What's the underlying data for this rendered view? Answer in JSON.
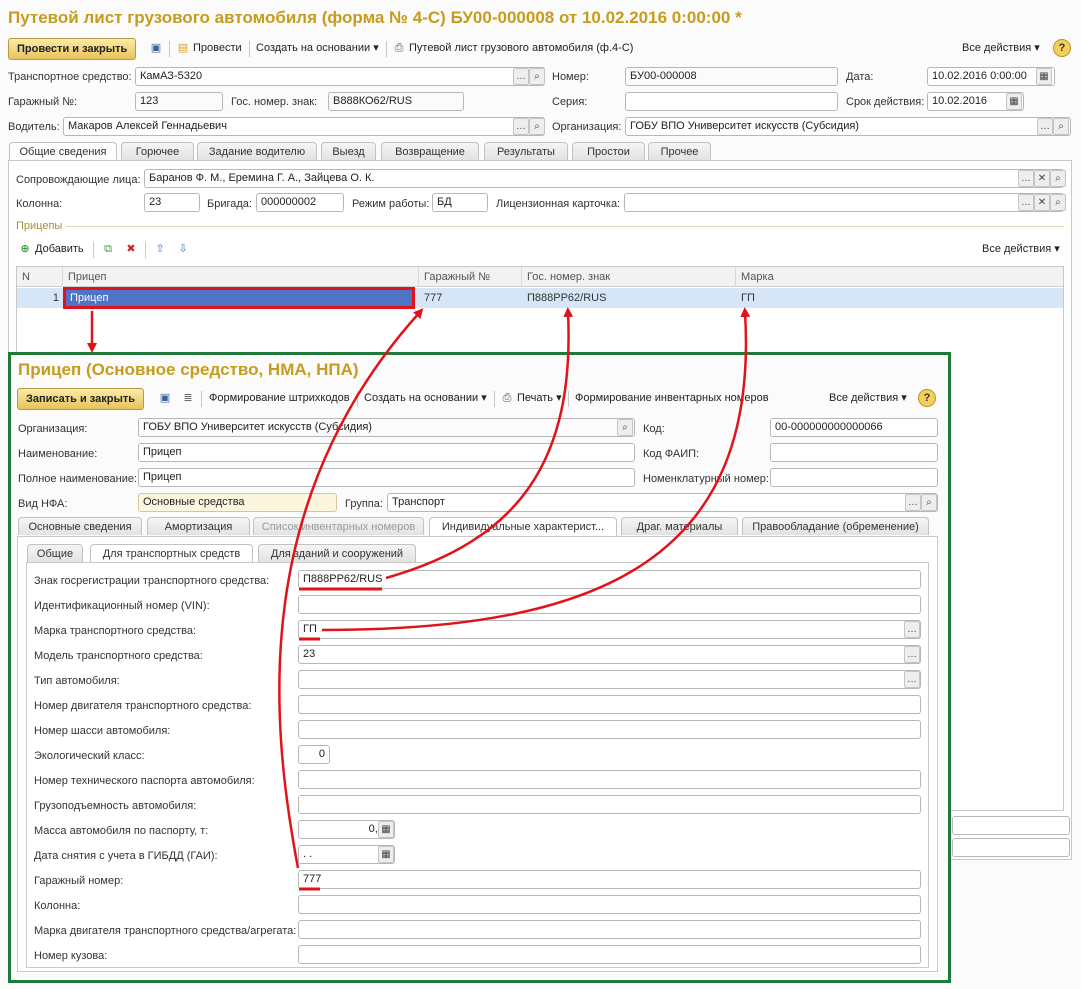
{
  "main": {
    "title": "Путевой лист грузового автомобиля (форма № 4-С) БУ00-000008 от 10.02.2016 0:00:00 *",
    "toolbar": {
      "post_close": "Провести и закрыть",
      "post": "Провести",
      "create_based": "Создать на основании",
      "print_form": "Путевой лист грузового автомобиля (ф.4-С)",
      "all_actions": "Все действия"
    },
    "fields": {
      "vehicle_label": "Транспортное средство:",
      "vehicle_value": "КамАЗ-5320",
      "number_label": "Номер:",
      "number_value": "БУ00-000008",
      "date_label": "Дата:",
      "date_value": "10.02.2016  0:00:00",
      "garage_label": "Гаражный №:",
      "garage_value": "123",
      "plate_label": "Гос. номер. знак:",
      "plate_value": "В888КО62/RUS",
      "series_label": "Серия:",
      "series_value": "",
      "validity_label": "Срок действия:",
      "validity_value": "10.02.2016",
      "driver_label": "Водитель:",
      "driver_value": "Макаров Алексей Геннадьевич",
      "org_label": "Организация:",
      "org_value": "ГОБУ ВПО Университет искусств (Субсидия)"
    },
    "tabs": [
      "Общие сведения",
      "Горючее",
      "Задание водителю",
      "Выезд",
      "Возвращение",
      "Результаты",
      "Простои",
      "Прочее"
    ],
    "general": {
      "escort_label": "Сопровождающие лица:",
      "escort_value": "Баранов Ф. М., Еремина Г. А., Зайцева О. К.",
      "column_label": "Колонна:",
      "column_value": "23",
      "brigade_label": "Бригада:",
      "brigade_value": "000000002",
      "mode_label": "Режим работы:",
      "mode_value": "БД",
      "license_label": "Лицензионная карточка:",
      "license_value": "",
      "trailers_section": "Прицепы",
      "add_label": "Добавить",
      "all_actions": "Все действия",
      "columns": [
        "N",
        "Прицеп",
        "Гаражный №",
        "Гос. номер. знак",
        "Марка"
      ],
      "rows": [
        {
          "n": "1",
          "trailer": "Прицеп",
          "garage": "777",
          "plate": "П888РР62/RUS",
          "brand": "ГП"
        }
      ]
    }
  },
  "sub": {
    "title": "Прицеп (Основное средство, НМА, НПА)",
    "toolbar": {
      "save_close": "Записать и закрыть",
      "barcodes": "Формирование штрихкодов",
      "create_based": "Создать на основании",
      "print": "Печать",
      "inventory": "Формирование инвентарных номеров",
      "all_actions": "Все действия",
      "help": "?"
    },
    "fields": {
      "org_label": "Организация:",
      "org_value": "ГОБУ ВПО Университет искусств (Субсидия)",
      "code_label": "Код:",
      "code_value": "00-000000000000066",
      "name_label": "Наименование:",
      "name_value": "Прицеп",
      "faip_label": "Код ФАИП:",
      "faip_value": "",
      "fullname_label": "Полное наименование:",
      "fullname_value": "Прицеп",
      "nomen_label": "Номенклатурный номер:",
      "nomen_value": "",
      "nfa_label": "Вид НФА:",
      "nfa_value": "Основные средства",
      "group_label": "Группа:",
      "group_value": "Транспорт"
    },
    "tabs": [
      "Основные сведения",
      "Амортизация",
      "Список инвентарных номеров",
      "Индивидуальные характерист...",
      "Драг. материалы",
      "Правообладание (обременение)"
    ],
    "subtabs": [
      "Общие",
      "Для транспортных средств",
      "Для зданий и сооружений"
    ],
    "props": [
      {
        "label": "Знак госрегистрации транспортного средства:",
        "value": "П888РР62/RUS"
      },
      {
        "label": "Идентификационный номер (VIN):",
        "value": ""
      },
      {
        "label": "Марка транспортного средства:",
        "value": "ГП"
      },
      {
        "label": "Модель транспортного средства:",
        "value": "23"
      },
      {
        "label": "Тип автомобиля:",
        "value": ""
      },
      {
        "label": "Номер двигателя транспортного средства:",
        "value": ""
      },
      {
        "label": "Номер шасси автомобиля:",
        "value": ""
      },
      {
        "label": "Экологический класс:",
        "value": "0"
      },
      {
        "label": "Номер технического паспорта автомобиля:",
        "value": ""
      },
      {
        "label": "Грузоподъемность автомобиля:",
        "value": ""
      },
      {
        "label": "Масса автомобиля по паспорту, т:",
        "value": "0,00"
      },
      {
        "label": "Дата снятия с учета в ГИБДД (ГАИ):",
        "value": "  .  ."
      },
      {
        "label": "Гаражный номер:",
        "value": "777"
      },
      {
        "label": "Колонна:",
        "value": ""
      },
      {
        "label": "Марка двигателя транспортного средства/агрегата:",
        "value": ""
      },
      {
        "label": "Номер кузова:",
        "value": ""
      }
    ]
  },
  "colors": {
    "title": "#c79c1c",
    "highlight": "#e0131b",
    "frame": "#1f7a3a",
    "selected_row": "#4f73c6"
  }
}
